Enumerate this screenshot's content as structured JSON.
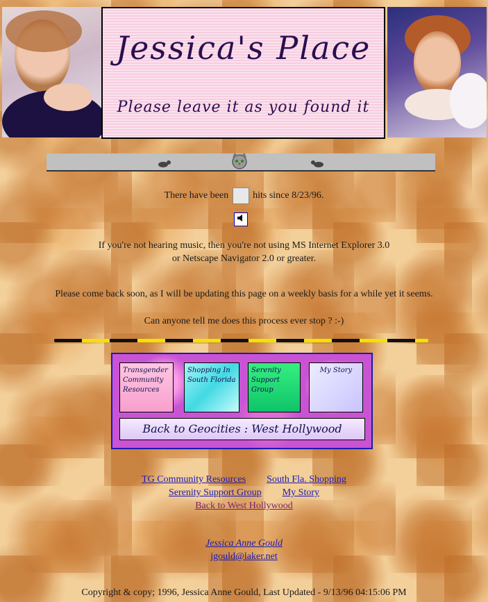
{
  "header": {
    "title": "Jessica's Place",
    "subtitle": "Please leave it as you found it"
  },
  "counter": {
    "before": "There have been",
    "after": "hits since 8/23/96."
  },
  "music_note": {
    "line1": "If you're not hearing music, then you're not using MS Internet Explorer 3.0",
    "line2": "or Netscape Navigator 2.0 or greater."
  },
  "message": {
    "line1": "Please come back soon, as I will be updating this page on a weekly basis for a while yet it seems.",
    "line2": "Can anyone tell me does this process ever stop ? :-)"
  },
  "nav_image": {
    "tile1": "Transgender Community Resources",
    "tile2": "Shopping In South Florida",
    "tile3": "Serenity Support Group",
    "tile4": "My Story",
    "back": "Back to Geocities : West Hollywood"
  },
  "text_links": {
    "tg": "TG Community Resources",
    "shopping": "South Fla. Shopping",
    "serenity": "Serenity Support Group",
    "story": "My Story",
    "back": "Back to West Hollywood"
  },
  "author": {
    "name": "Jessica Anne Gould",
    "email": "jgould@laker.net"
  },
  "footer": {
    "text": "Copyright & copy; 1996, Jessica Anne Gould, Last Updated - 9/13/96 04:15:06 PM"
  }
}
